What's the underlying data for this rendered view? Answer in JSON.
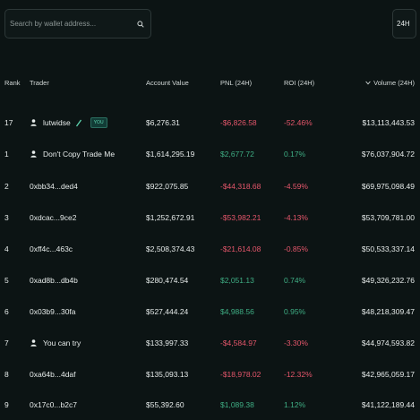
{
  "search": {
    "placeholder": "Search by wallet address..."
  },
  "period": {
    "value": "24H"
  },
  "table": {
    "headers": {
      "rank": "Rank",
      "trader": "Trader",
      "account_value": "Account Value",
      "pnl": "PNL (24H)",
      "roi": "ROI (24H)",
      "volume": "Volume (24H)"
    },
    "rows": [
      {
        "rank": "17",
        "trader": "lutwidse",
        "account_value": "$6,276.31",
        "pnl": "-$6,826.58",
        "roi": "-52.46%",
        "volume": "$13,113,443.53",
        "badge": "YOU"
      },
      {
        "rank": "1",
        "trader": "Don't Copy Trade Me",
        "account_value": "$1,614,295.19",
        "pnl": "$2,677.72",
        "roi": "0.17%",
        "volume": "$76,037,904.72"
      },
      {
        "rank": "2",
        "trader": "0xbb34...ded4",
        "account_value": "$922,075.85",
        "pnl": "-$44,318.68",
        "roi": "-4.59%",
        "volume": "$69,975,098.49"
      },
      {
        "rank": "3",
        "trader": "0xdcac...9ce2",
        "account_value": "$1,252,672.91",
        "pnl": "-$53,982.21",
        "roi": "-4.13%",
        "volume": "$53,709,781.00"
      },
      {
        "rank": "4",
        "trader": "0xff4c...463c",
        "account_value": "$2,508,374.43",
        "pnl": "-$21,614.08",
        "roi": "-0.85%",
        "volume": "$50,533,337.14"
      },
      {
        "rank": "5",
        "trader": "0xad8b...db4b",
        "account_value": "$280,474.54",
        "pnl": "$2,051.13",
        "roi": "0.74%",
        "volume": "$49,326,232.76"
      },
      {
        "rank": "6",
        "trader": "0x03b9...30fa",
        "account_value": "$527,444.24",
        "pnl": "$4,988.56",
        "roi": "0.95%",
        "volume": "$48,218,309.47"
      },
      {
        "rank": "7",
        "trader": "You can try",
        "account_value": "$133,997.33",
        "pnl": "-$4,584.97",
        "roi": "-3.30%",
        "volume": "$44,974,593.82"
      },
      {
        "rank": "8",
        "trader": "0xa64b...4daf",
        "account_value": "$135,093.13",
        "pnl": "-$18,978.02",
        "roi": "-12.32%",
        "volume": "$42,965,059.17"
      },
      {
        "rank": "9",
        "trader": "0x17c0...b2c7",
        "account_value": "$55,392.60",
        "pnl": "$1,089.38",
        "roi": "1.12%",
        "volume": "$41,122,189.44"
      }
    ]
  },
  "colors": {
    "background": "#0c1414",
    "negative": "#e5566b",
    "positive": "#3fae84",
    "badge": "#5ed6b0"
  },
  "icons": {
    "search": "search-icon",
    "user": "user-icon",
    "edit": "pencil-icon",
    "sort": "chevron-down-icon"
  }
}
